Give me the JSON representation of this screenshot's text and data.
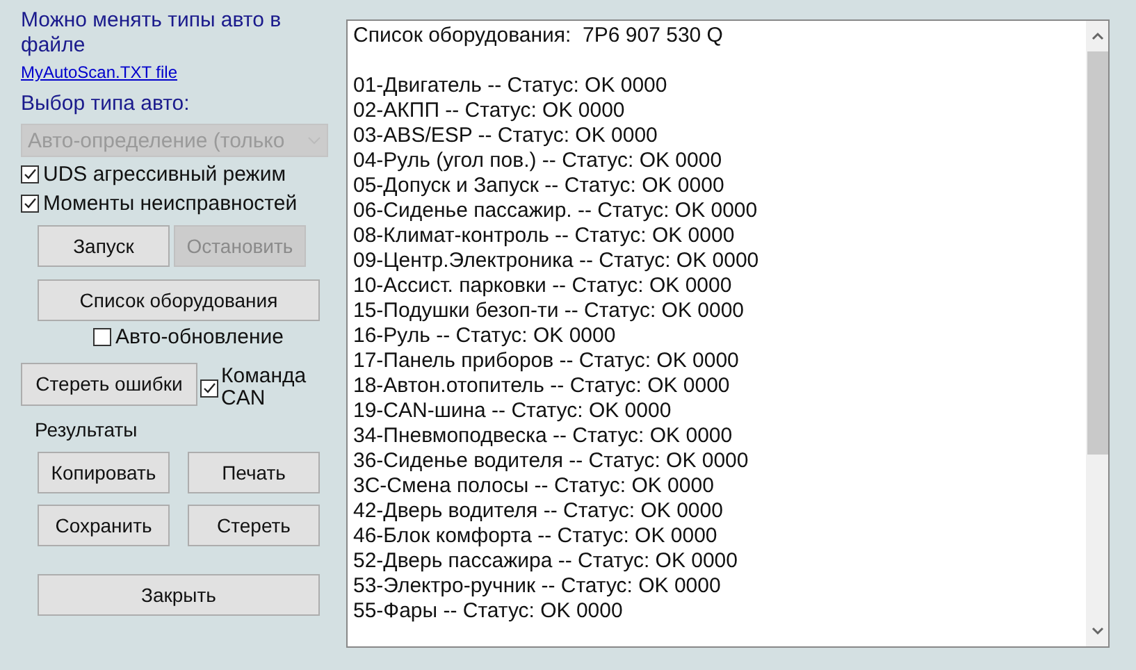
{
  "info": {
    "text": "Можно менять типы авто в файле",
    "link": "MyAutoScan.TXT file"
  },
  "car_type": {
    "label": "Выбор типа авто:",
    "value": "Авто-определение (только",
    "disabled": true
  },
  "options": [
    {
      "label": "UDS агрессивный режим",
      "checked": true
    },
    {
      "label": "Моменты неисправностей",
      "checked": true
    }
  ],
  "run_buttons": [
    {
      "label": "Запуск",
      "disabled": false
    },
    {
      "label": "Остановить",
      "disabled": true
    }
  ],
  "equipment_button": "Список оборудования",
  "auto_update": {
    "label": "Авто-обновление",
    "checked": false
  },
  "clear_errors_button": "Стереть ошибки",
  "can_command": {
    "label": "Команда CAN",
    "checked": true
  },
  "results": {
    "label": "Результаты",
    "buttons": [
      "Копировать",
      "Печать",
      "Сохранить",
      "Стереть"
    ]
  },
  "close_button": "Закрыть",
  "output": {
    "header": "Список оборудования:  7P6 907 530 Q",
    "lines": [
      "01-Двигатель -- Статус: OK 0000",
      "02-АКПП -- Статус: OK 0000",
      "03-ABS/ESP -- Статус: OK 0000",
      "04-Руль (угол пов.) -- Статус: OK 0000",
      "05-Допуск и Запуск -- Статус: OK 0000",
      "06-Сиденье пассажир. -- Статус: OK 0000",
      "08-Климат-контроль -- Статус: OK 0000",
      "09-Центр.Электроника -- Статус: OK 0000",
      "10-Ассист. парковки -- Статус: OK 0000",
      "15-Подушки безоп-ти -- Статус: OK 0000",
      "16-Руль -- Статус: OK 0000",
      "17-Панель приборов -- Статус: OK 0000",
      "18-Автон.отопитель -- Статус: OK 0000",
      "19-CAN-шина -- Статус: OK 0000",
      "34-Пневмоподвеска -- Статус: OK 0000",
      "36-Сиденье водителя -- Статус: OK 0000",
      "3C-Смена полосы -- Статус: OK 0000",
      "42-Дверь водителя -- Статус: OK 0000",
      "46-Блок комфорта -- Статус: OK 0000",
      "52-Дверь пассажира -- Статус: OK 0000",
      "53-Электро-ручник -- Статус: OK 0000",
      "55-Фары -- Статус: OK 0000"
    ]
  }
}
